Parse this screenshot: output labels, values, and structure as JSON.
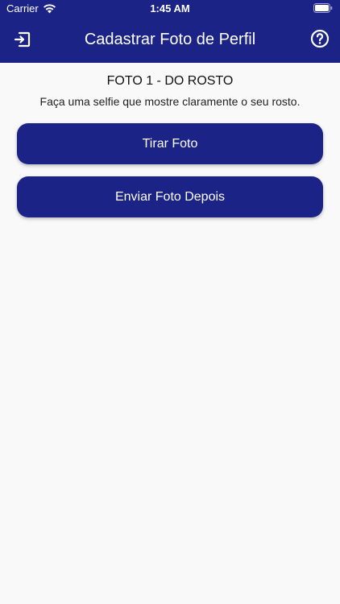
{
  "status_bar": {
    "carrier": "Carrier",
    "time": "1:45 AM",
    "wifi_icon": "wifi-icon",
    "battery_icon": "battery-icon"
  },
  "header": {
    "title": "Cadastrar Foto de Perfil",
    "left_icon": "exit-icon",
    "right_icon": "help-icon",
    "color": "#1b2386"
  },
  "main": {
    "section_title": "FOTO 1 - DO ROSTO",
    "instruction": "Faça uma selfie que mostre claramente o seu rosto.",
    "take_photo_label": "Tirar Foto",
    "send_later_label": "Enviar Foto Depois",
    "button_color": "#1b2386"
  },
  "colors": {
    "background": "#f9f9f9",
    "text_on_primary": "#ffffff"
  }
}
